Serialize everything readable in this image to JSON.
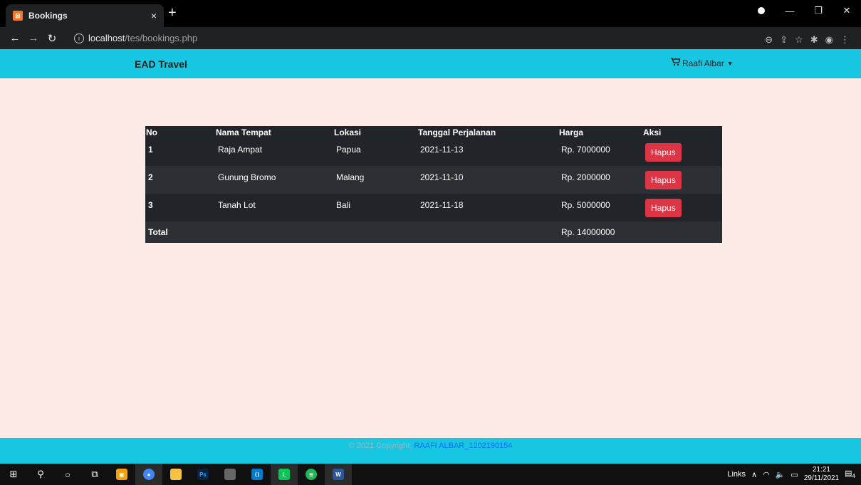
{
  "browser": {
    "tab_title": "Bookings",
    "tab_close": "×",
    "new_tab": "+",
    "url_host": "localhost",
    "url_path": "/tes/bookings.php"
  },
  "navbar": {
    "brand": "EAD Travel",
    "user": "Raafi Albar"
  },
  "table": {
    "headers": [
      "No",
      "Nama Tempat",
      "Lokasi",
      "Tanggal Perjalanan",
      "Harga",
      "Aksi"
    ],
    "rows": [
      {
        "no": "1",
        "nama": "Raja Ampat",
        "lokasi": "Papua",
        "tanggal": "2021-11-13",
        "harga": "Rp. 7000000",
        "aksi": "Hapus"
      },
      {
        "no": "2",
        "nama": "Gunung Bromo",
        "lokasi": "Malang",
        "tanggal": "2021-11-10",
        "harga": "Rp. 2000000",
        "aksi": "Hapus"
      },
      {
        "no": "3",
        "nama": "Tanah Lot",
        "lokasi": "Bali",
        "tanggal": "2021-11-18",
        "harga": "Rp. 5000000",
        "aksi": "Hapus"
      }
    ],
    "total_label": "Total",
    "total_value": "Rp. 14000000"
  },
  "footer": {
    "copyright": "© 2021 Copyright: ",
    "author": "RAAFI ALBAR_1202190154"
  },
  "taskbar": {
    "links_label": "Links",
    "time": "21:21",
    "date": "29/11/2021",
    "notifications": "4"
  },
  "colors": {
    "navbar": "#17c6e0",
    "page_bg": "#fcebe7",
    "danger": "#dc3545",
    "table_dark": "#212529"
  }
}
